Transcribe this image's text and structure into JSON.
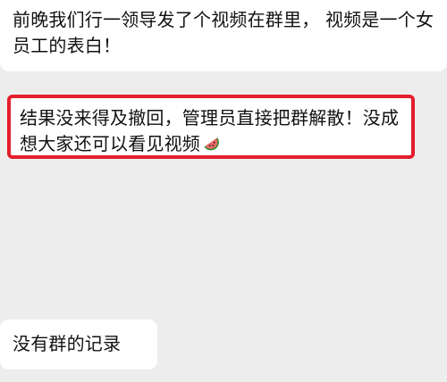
{
  "messages": [
    {
      "text": "前晚我们行一领导发了个视频在群里， 视频是一个女员工的表白！"
    },
    {
      "text": "结果没来得及撤回，管理员直接把群解散！没成想大家还可以看见视频",
      "emoji": "watermelon",
      "highlight_color": "#e41e2c"
    },
    {
      "text": "没有群的记录"
    }
  ],
  "colors": {
    "background": "#ededed",
    "bubble": "#ffffff",
    "text": "#111111"
  }
}
